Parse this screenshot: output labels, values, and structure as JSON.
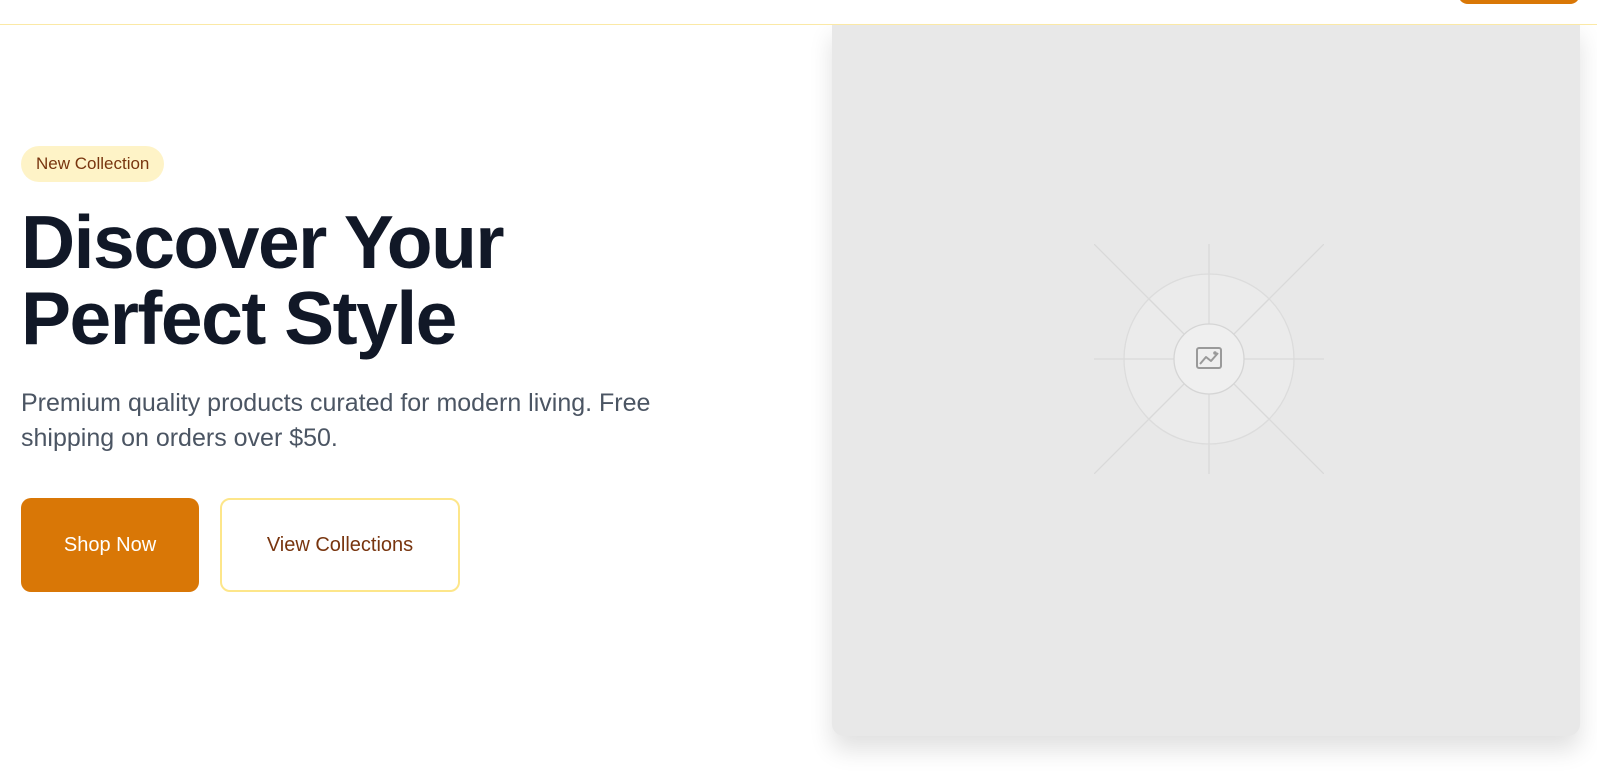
{
  "header": {
    "cta_icon": "button-cutoff"
  },
  "hero": {
    "badge": "New Collection",
    "title_line1": "Discover Your",
    "title_line2": "Perfect Style",
    "subtitle": "Premium quality products curated for modern living. Free shipping on orders over $50.",
    "primary_button": "Shop Now",
    "secondary_button": "View Collections"
  },
  "image": {
    "icon": "image-placeholder-icon"
  },
  "colors": {
    "accent": "#d97706",
    "badge_bg": "#fef3c7",
    "badge_text": "#78350f",
    "heading": "#111827",
    "body_text": "#4b5563",
    "outline_border": "#fde68a",
    "image_bg": "#e8e8e8"
  }
}
